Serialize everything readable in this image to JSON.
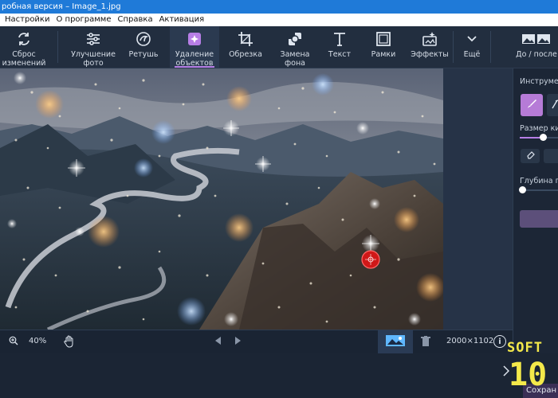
{
  "window": {
    "title": "робная версия – Image_1.jpg"
  },
  "menu": {
    "items": [
      "Настройки",
      "О программе",
      "Справка",
      "Активация"
    ]
  },
  "toolbar": {
    "tools": [
      {
        "label": "Сброс\nизменений",
        "icon": "reset-icon"
      },
      {
        "label": "Улучшение\nфото",
        "icon": "sliders-icon"
      },
      {
        "label": "Ретушь",
        "icon": "retouch-icon"
      },
      {
        "label": "Удаление\nобъектов",
        "icon": "remove-objects-icon",
        "active": true
      },
      {
        "label": "Обрезка",
        "icon": "crop-icon"
      },
      {
        "label": "Замена\nфона",
        "icon": "background-replace-icon"
      },
      {
        "label": "Текст",
        "icon": "text-icon"
      },
      {
        "label": "Рамки",
        "icon": "frame-icon"
      },
      {
        "label": "Эффекты",
        "icon": "effects-icon"
      },
      {
        "label": "Ещё",
        "icon": "chevron-down-icon"
      }
    ],
    "compare_label": "До / после"
  },
  "right_panel": {
    "tools_heading": "Инструмент",
    "brush_size_label": "Размер ки",
    "depth_label": "Глубина п"
  },
  "status": {
    "zoom": "40%",
    "dimensions": "2000×1102"
  },
  "bottom": {
    "save_label": "Сохран"
  },
  "watermark": {
    "line1": "SOFT",
    "line2": "10"
  },
  "colors": {
    "accent": "#b77ee6",
    "brush_button": "#b67bd7",
    "apply_button": "#5c4f7a",
    "titlebar": "#1f7ad8",
    "toolbar_bg": "#222e3f",
    "watermark": "#f4e94a"
  }
}
